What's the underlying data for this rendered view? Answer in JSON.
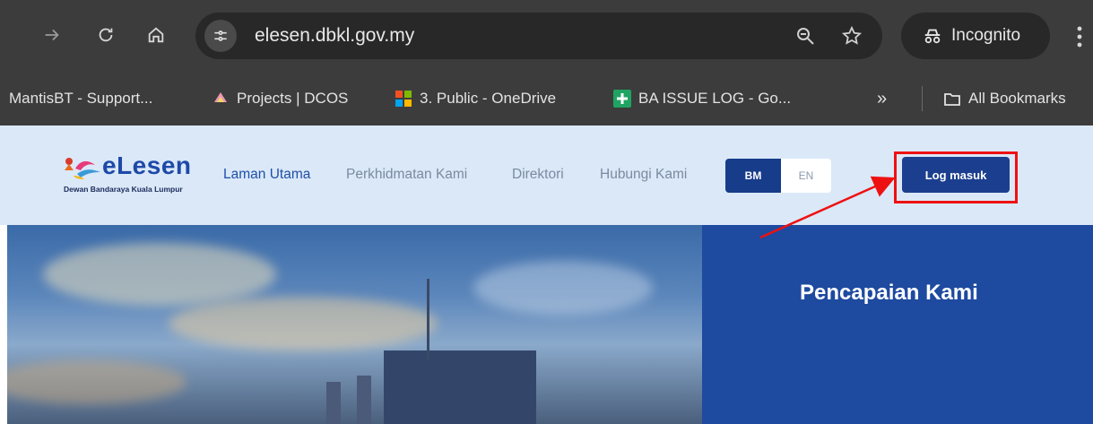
{
  "browser": {
    "url": "elesen.dbkl.gov.my",
    "incognito_label": "Incognito",
    "bookmarks": [
      {
        "label": "MantisBT - Support..."
      },
      {
        "label": "Projects | DCOS"
      },
      {
        "label": "3. Public - OneDrive"
      },
      {
        "label": "BA ISSUE LOG - Go..."
      }
    ],
    "overflow_label": "»",
    "all_bookmarks_label": "All Bookmarks"
  },
  "site": {
    "logo_text": "eLesen",
    "logo_subtitle": "Dewan Bandaraya Kuala Lumpur",
    "nav": [
      {
        "label": "Laman Utama",
        "active": true
      },
      {
        "label": "Perkhidmatan Kami",
        "active": false
      },
      {
        "label": "Direktori",
        "active": false
      },
      {
        "label": "Hubungi Kami",
        "active": false
      }
    ],
    "lang_bm": "BM",
    "lang_en": "EN",
    "login_label": "Log masuk",
    "section_title": "Pencapaian Kami"
  },
  "colors": {
    "header_bg": "#dbe8f8",
    "primary": "#1b3f8e",
    "annotation": "#ee1111"
  }
}
